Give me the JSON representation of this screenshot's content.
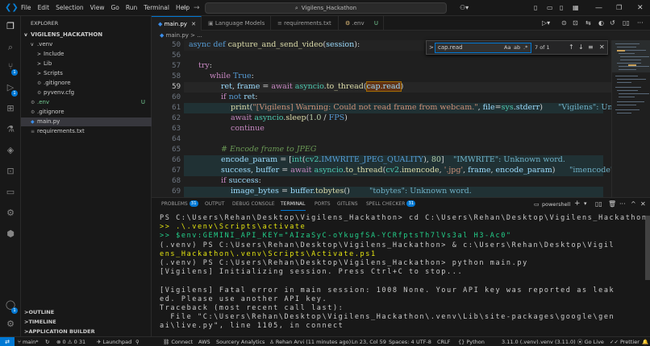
{
  "titlebar": {
    "menu": [
      "File",
      "Edit",
      "Selection",
      "View",
      "Go",
      "Run",
      "Terminal",
      "Help"
    ],
    "search_text": "Vigilens_Hackathon"
  },
  "activity": {
    "source_control_badge": "1",
    "run_badge": "1"
  },
  "sidebar": {
    "header": "EXPLORER",
    "root": "VIGILENS_HACKATHON",
    "tree": [
      {
        "label": ".venv",
        "indent": 1,
        "chev": "v"
      },
      {
        "label": "Include",
        "indent": 2,
        "chev": ">"
      },
      {
        "label": "Lib",
        "indent": 2,
        "chev": ">"
      },
      {
        "label": "Scripts",
        "indent": 2,
        "chev": ">"
      },
      {
        "label": ".gitignore",
        "indent": 2,
        "chev": ""
      },
      {
        "label": "pyvenv.cfg",
        "indent": 2,
        "chev": ""
      },
      {
        "label": ".env",
        "indent": 1,
        "chev": "",
        "status": "U"
      },
      {
        "label": ".gitignore",
        "indent": 1,
        "chev": ""
      },
      {
        "label": "main.py",
        "indent": 1,
        "chev": "",
        "selected": true
      },
      {
        "label": "requirements.txt",
        "indent": 1,
        "chev": ""
      }
    ],
    "sections": [
      "OUTLINE",
      "TIMELINE",
      "APPLICATION BUILDER"
    ]
  },
  "tabs": [
    {
      "label": "main.py",
      "active": true
    },
    {
      "label": "Language Models",
      "active": false
    },
    {
      "label": "requirements.txt",
      "active": false
    },
    {
      "label": ".env",
      "active": false,
      "status": "U"
    }
  ],
  "breadcrumb": "main.py > ...",
  "find": {
    "query": "cap.read",
    "options": "Aa  ab  .*",
    "count": "7 of 1"
  },
  "editor": {
    "lines": [
      {
        "n": "50",
        "html_key": "l50"
      },
      {
        "n": "56",
        "html_key": "l56"
      },
      {
        "n": "57",
        "html_key": "l57"
      },
      {
        "n": "58",
        "html_key": "l58"
      },
      {
        "n": "59",
        "html_key": "l59"
      },
      {
        "n": "60",
        "html_key": "l60"
      },
      {
        "n": "61",
        "html_key": "l61"
      },
      {
        "n": "62",
        "html_key": "l62"
      },
      {
        "n": "63",
        "html_key": "l63"
      },
      {
        "n": "64",
        "html_key": "l64"
      },
      {
        "n": "65",
        "html_key": "l65"
      },
      {
        "n": "66",
        "html_key": "l66"
      },
      {
        "n": "67",
        "html_key": "l67"
      },
      {
        "n": "68",
        "html_key": "l68"
      },
      {
        "n": "69",
        "html_key": "l69"
      }
    ],
    "code": {
      "l50": "async def capture_and_send_video(session):",
      "l56": "",
      "l57": "try:",
      "l58": "while True:",
      "l59": "ret, frame = await asyncio.to_thread(cap.read)",
      "l60": "if not ret:",
      "l61": "print(\"[Vigilens] Warning: Could not read frame from webcam.\", file=sys.stderr)",
      "l61_err": "\"Vigilens\": Unk",
      "l62": "await asyncio.sleep(1.0 / FPS)",
      "l63": "continue",
      "l64": "",
      "l65": "# Encode frame to JPEG",
      "l66": "encode_param = [int(cv2.IMWRITE_JPEG_QUALITY), 80]",
      "l66_err": "\"IMWRITE\": Unknown word.",
      "l67": "success, buffer = await asyncio.to_thread(cv2.imencode, '.jpg', frame, encode_param)",
      "l67_err": "\"imencode\":",
      "l68": "if success:",
      "l69": "image_bytes = buffer.tobytes()",
      "l69_err": "\"tobytes\": Unknown word."
    }
  },
  "panel": {
    "tabs": [
      {
        "label": "PROBLEMS",
        "badge": "31"
      },
      {
        "label": "OUTPUT"
      },
      {
        "label": "DEBUG CONSOLE"
      },
      {
        "label": "TERMINAL",
        "active": true
      },
      {
        "label": "PORTS"
      },
      {
        "label": "GITLENS"
      },
      {
        "label": "SPELL CHECKER",
        "badge": "31"
      }
    ],
    "shell": "powershell",
    "terminal": [
      {
        "text": "PS C:\\Users\\Rehan\\Desktop\\Vigilens_Hackathon> cd C:\\Users\\Rehan\\Desktop\\Vigilens_Hackathon",
        "cls": ""
      },
      {
        "text": ">> .\\.venv\\Scripts\\activate",
        "cls": "t-y"
      },
      {
        "text": ">> $env:GEMINI_API_KEY=\"AIzaSyC-oYkugfSA-YCRfptsTh7lVs3al H3-Ac0\"",
        "cls": "t-g"
      },
      {
        "text": "(.venv) PS C:\\Users\\Rehan\\Desktop\\Vigilens_Hackathon> & c:\\Users\\Rehan\\Desktop\\Vigil",
        "cls": ""
      },
      {
        "text": "ens_Hackathon\\.venv\\Scripts\\Activate.ps1",
        "cls": "t-y"
      },
      {
        "text": "(.venv) PS C:\\Users\\Rehan\\Desktop\\Vigilens_Hackathon> python main.py",
        "cls": ""
      },
      {
        "text": "[Vigilens] Initializing session. Press Ctrl+C to stop...",
        "cls": ""
      },
      {
        "text": "",
        "cls": ""
      },
      {
        "text": "[Vigilens] Fatal error in main session: 1008 None. Your API key was reported as leak",
        "cls": ""
      },
      {
        "text": "ed. Please use another API key.",
        "cls": ""
      },
      {
        "text": "Traceback (most recent call last):",
        "cls": ""
      },
      {
        "text": "  File \"C:\\Users\\Rehan\\Desktop\\Vigilens_Hackathon\\.venv\\Lib\\site-packages\\google\\gen",
        "cls": ""
      },
      {
        "text": "ai\\live.py\", line 1105, in connect",
        "cls": ""
      }
    ]
  },
  "status": {
    "branch": "main*",
    "errors": "0",
    "warnings": "0",
    "info": "31",
    "launchpad": "Launchpad",
    "connect": "Connect",
    "aws": "AWS",
    "sourcery": "Sourcery Analytics",
    "author": "Rehan Arvi (11 minutes ago)",
    "position": "Ln 23, Col 59",
    "spaces": "Spaces: 4",
    "encoding": "UTF-8",
    "eol": "CRLF",
    "language": "Python",
    "interpreter": "3.11.0 (.venv)",
    "venv": ".venv (3.11.0)",
    "golive": "Go Live",
    "prettier": "Prettier"
  }
}
